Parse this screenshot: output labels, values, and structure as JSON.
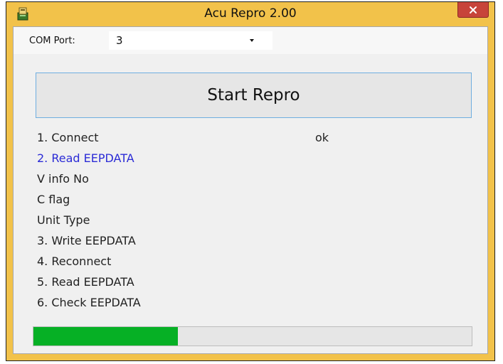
{
  "window": {
    "title": "Acu Repro 2.00",
    "close_glyph": "✕",
    "icon": "app-icon"
  },
  "com_port": {
    "label": "COM Port:",
    "selected": "3"
  },
  "start_button": {
    "label": "Start Repro"
  },
  "steps": [
    {
      "label": "1. Connect",
      "status": "ok",
      "active": false
    },
    {
      "label": "2. Read EEPDATA",
      "status": "",
      "active": true
    },
    {
      "label": "V info No",
      "status": "",
      "active": false
    },
    {
      "label": "C flag",
      "status": "",
      "active": false
    },
    {
      "label": "Unit Type",
      "status": "",
      "active": false
    },
    {
      "label": "3. Write EEPDATA",
      "status": "",
      "active": false
    },
    {
      "label": "4. Reconnect",
      "status": "",
      "active": false
    },
    {
      "label": "5. Read EEPDATA",
      "status": "",
      "active": false
    },
    {
      "label": "6. Check EEPDATA",
      "status": "",
      "active": false
    }
  ],
  "progress": {
    "value": 0.33
  },
  "colors": {
    "title_bar": "#f2c24a",
    "close_button": "#c7443a",
    "active_step": "#2b2bd6",
    "progress_fill": "#06b025",
    "button_border": "#6eaee0"
  }
}
